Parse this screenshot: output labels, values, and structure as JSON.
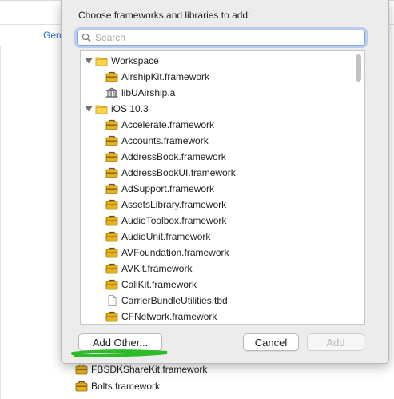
{
  "background": {
    "tab_left": "General",
    "tab_right": "s",
    "items": [
      {
        "label": "FBSDKShareKit.framework",
        "icon": "framework-toolbox-icon"
      },
      {
        "label": "Bolts.framework",
        "icon": "framework-toolbox-icon"
      }
    ]
  },
  "sheet": {
    "title": "Choose frameworks and libraries to add:",
    "search": {
      "placeholder": "Search",
      "value": ""
    },
    "rows": [
      {
        "label": "Workspace",
        "kind": "group",
        "icon": "folder-icon"
      },
      {
        "label": "AirshipKit.framework",
        "kind": "framework",
        "icon": "framework-toolbox-icon"
      },
      {
        "label": "libUAirship.a",
        "kind": "library",
        "icon": "library-building-icon"
      },
      {
        "label": "iOS 10.3",
        "kind": "group",
        "icon": "folder-icon"
      },
      {
        "label": "Accelerate.framework",
        "kind": "framework",
        "icon": "framework-toolbox-icon"
      },
      {
        "label": "Accounts.framework",
        "kind": "framework",
        "icon": "framework-toolbox-icon"
      },
      {
        "label": "AddressBook.framework",
        "kind": "framework",
        "icon": "framework-toolbox-icon"
      },
      {
        "label": "AddressBookUI.framework",
        "kind": "framework",
        "icon": "framework-toolbox-icon"
      },
      {
        "label": "AdSupport.framework",
        "kind": "framework",
        "icon": "framework-toolbox-icon"
      },
      {
        "label": "AssetsLibrary.framework",
        "kind": "framework",
        "icon": "framework-toolbox-icon"
      },
      {
        "label": "AudioToolbox.framework",
        "kind": "framework",
        "icon": "framework-toolbox-icon"
      },
      {
        "label": "AudioUnit.framework",
        "kind": "framework",
        "icon": "framework-toolbox-icon"
      },
      {
        "label": "AVFoundation.framework",
        "kind": "framework",
        "icon": "framework-toolbox-icon"
      },
      {
        "label": "AVKit.framework",
        "kind": "framework",
        "icon": "framework-toolbox-icon"
      },
      {
        "label": "CallKit.framework",
        "kind": "framework",
        "icon": "framework-toolbox-icon"
      },
      {
        "label": "CarrierBundleUtilities.tbd",
        "kind": "file",
        "icon": "document-icon"
      },
      {
        "label": "CFNetwork.framework",
        "kind": "framework",
        "icon": "framework-toolbox-icon"
      }
    ],
    "buttons": {
      "add_other": "Add Other...",
      "cancel": "Cancel",
      "add": "Add"
    }
  },
  "colors": {
    "annotation_green": "#2dbb2a",
    "focus_blue": "#7aa8e8",
    "toolbox_gold": "#e5b21e"
  }
}
